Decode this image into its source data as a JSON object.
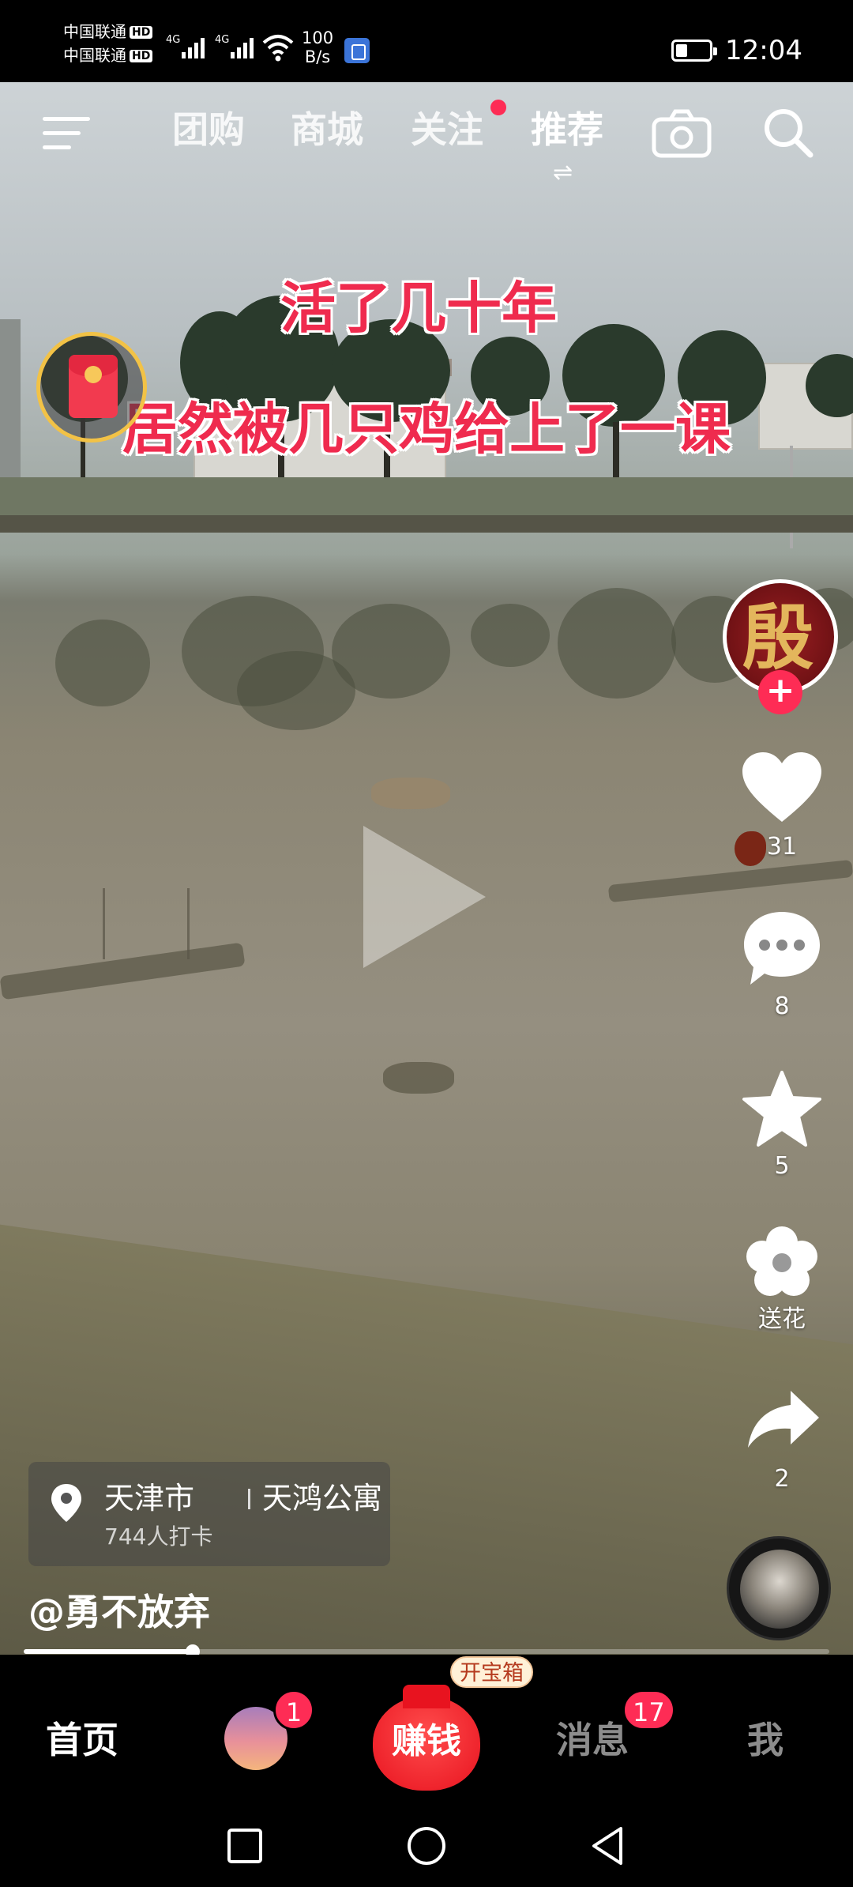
{
  "status_bar": {
    "carrier1": "中国联通",
    "carrier2": "中国联通",
    "hd": "HD",
    "network1": "4G",
    "network2": "4G",
    "speed_value": "100",
    "speed_unit": "B/s",
    "time": "12:04",
    "battery_level_percent": 35
  },
  "top_nav": {
    "tabs": [
      {
        "label": "团购",
        "active": false
      },
      {
        "label": "商城",
        "active": false
      },
      {
        "label": "关注",
        "active": false,
        "has_dot": true
      },
      {
        "label": "推荐",
        "active": true
      }
    ],
    "icons": [
      "menu-icon",
      "camera-icon",
      "search-icon"
    ]
  },
  "video": {
    "caption_line1": "活了几十年",
    "caption_line2": "居然被几只鸡给上了一课",
    "progress_fraction": 0.21
  },
  "actions": {
    "author_avatar_glyph": "殷",
    "like_count": "31",
    "comment_count": "8",
    "favorite_count": "5",
    "flower_label": "送花",
    "share_count": "2"
  },
  "location": {
    "city": "天津市",
    "place": "天鸿公寓",
    "checkins": "744人打卡"
  },
  "author": {
    "handle": "@勇不放弃"
  },
  "tab_bar": {
    "home": "首页",
    "friends_badge": "1",
    "earn_label": "赚钱",
    "chest_tag": "开宝箱",
    "messages": "消息",
    "messages_badge": "17",
    "me": "我"
  },
  "colors": {
    "accent": "#fe2c55",
    "caption_red": "#ef2b4e",
    "earn_red": "#e8131f"
  }
}
